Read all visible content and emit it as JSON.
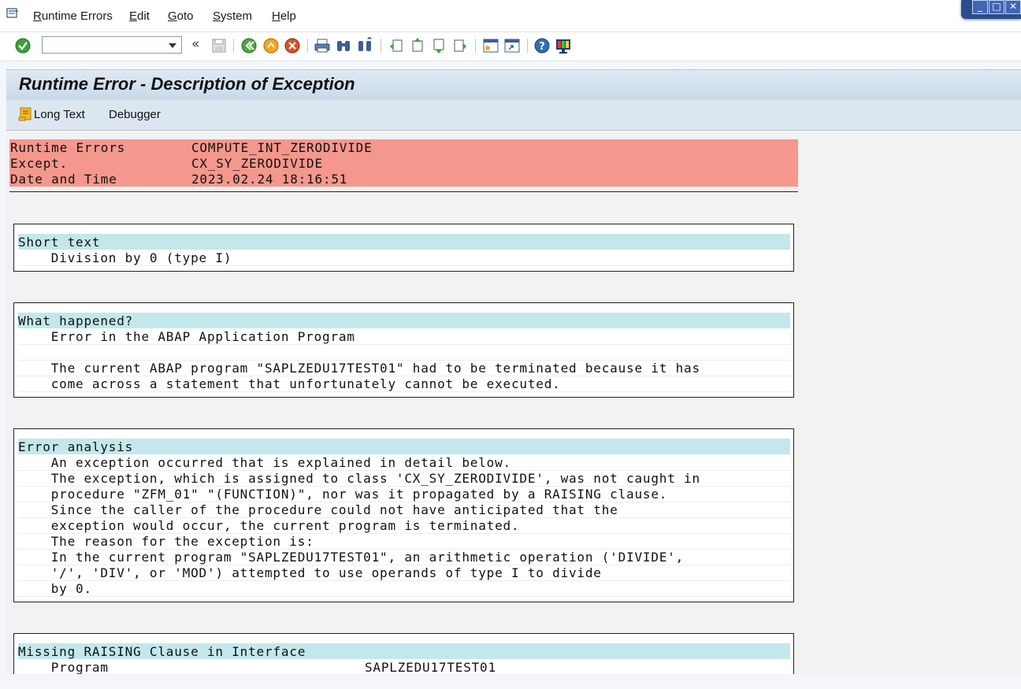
{
  "menubar": {
    "items": [
      {
        "label": "Runtime Errors",
        "accel": "R",
        "rest": "untime Errors"
      },
      {
        "label": "Edit",
        "accel": "E",
        "rest": "dit"
      },
      {
        "label": "Goto",
        "accel": "G",
        "rest": "oto"
      },
      {
        "label": "System",
        "accel": "S",
        "rest": "ystem"
      },
      {
        "label": "Help",
        "accel": "H",
        "rest": "elp"
      }
    ]
  },
  "toolbar": {
    "command_field_value": "",
    "collapse_label": "«"
  },
  "title": "Runtime Error - Description of Exception",
  "app_toolbar": {
    "long_text_label": "Long Text",
    "debugger_label": "Debugger"
  },
  "header": [
    {
      "key": "Runtime Errors",
      "value": "COMPUTE_INT_ZERODIVIDE"
    },
    {
      "key": "Except.",
      "value": "CX_SY_ZERODIVIDE"
    },
    {
      "key": "Date and Time",
      "value": "2023.02.24 18:16:51"
    }
  ],
  "sections": {
    "short_text": {
      "heading": "Short text",
      "lines": [
        "    Division by 0 (type I)"
      ]
    },
    "what_happened": {
      "heading": "What happened?",
      "lines": [
        "    Error in the ABAP Application Program",
        "",
        "    The current ABAP program \"SAPLZEDU17TEST01\" had to be terminated because it has",
        "    come across a statement that unfortunately cannot be executed."
      ]
    },
    "error_analysis": {
      "heading": "Error analysis",
      "lines": [
        "    An exception occurred that is explained in detail below.",
        "    The exception, which is assigned to class 'CX_SY_ZERODIVIDE', was not caught in",
        "    procedure \"ZFM_01\" \"(FUNCTION)\", nor was it propagated by a RAISING clause.",
        "    Since the caller of the procedure could not have anticipated that the",
        "    exception would occur, the current program is terminated.",
        "    The reason for the exception is:",
        "    In the current program \"SAPLZEDU17TEST01\", an arithmetic operation ('DIVIDE',",
        "    '/', 'DIV', or 'MOD') attempted to use operands of type I to divide",
        "    by 0."
      ]
    },
    "missing_raising": {
      "heading": "Missing RAISING Clause in Interface",
      "program_label": "    Program",
      "program_value": "SAPLZEDU17TEST01"
    }
  },
  "colors": {
    "header_bg": "#f4978c",
    "section_head_bg": "#c3e8ec"
  }
}
